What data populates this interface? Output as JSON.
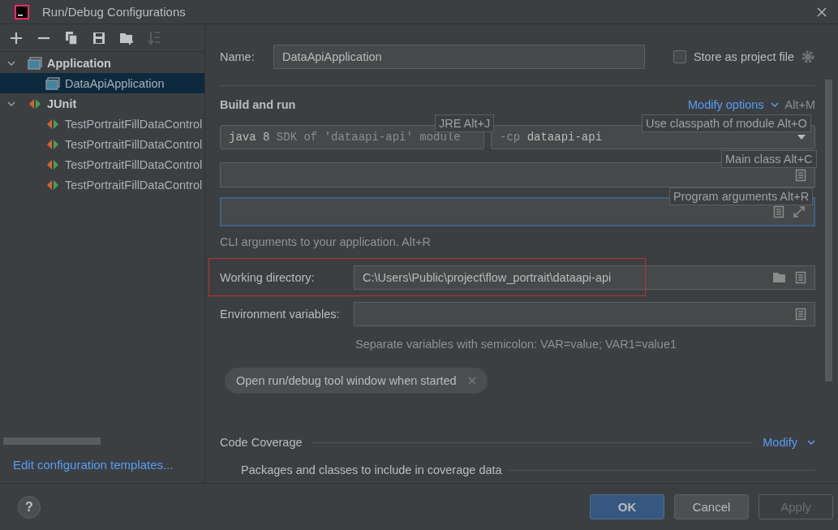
{
  "window": {
    "title": "Run/Debug Configurations"
  },
  "toolbar": [
    {
      "kind": "add",
      "disabled": false
    },
    {
      "kind": "remove",
      "disabled": false
    },
    {
      "kind": "copy",
      "disabled": false
    },
    {
      "kind": "save",
      "disabled": false
    },
    {
      "kind": "folder",
      "disabled": false
    },
    {
      "kind": "sort",
      "disabled": true
    }
  ],
  "tree": [
    {
      "label": "Application",
      "kind": "app",
      "expanded": true,
      "selected": false,
      "children": [
        {
          "label": "DataApiApplication",
          "kind": "app",
          "selected": true
        }
      ]
    },
    {
      "label": "JUnit",
      "kind": "junit",
      "expanded": true,
      "selected": false,
      "children": [
        {
          "label": "TestPortraitFillDataControl",
          "kind": "junit",
          "selected": false
        },
        {
          "label": "TestPortraitFillDataControl",
          "kind": "junit",
          "selected": false
        },
        {
          "label": "TestPortraitFillDataControl",
          "kind": "junit",
          "selected": false
        },
        {
          "label": "TestPortraitFillDataControl",
          "kind": "junit",
          "selected": false
        }
      ]
    }
  ],
  "templates_link": "Edit configuration templates...",
  "name": {
    "label": "Name:",
    "value": "DataApiApplication"
  },
  "store_as_project_file": {
    "label": "Store as project file",
    "checked": false
  },
  "build_and_run": {
    "title": "Build and run",
    "modify_options": "Modify options",
    "modify_shortcut": "Alt+M",
    "jre": {
      "value": "java 8",
      "detail": "SDK of 'dataapi-api' module"
    },
    "classpath": {
      "prefix": "-cp",
      "value": "dataapi-api"
    },
    "program_arguments": {
      "focused": true
    },
    "hint": "CLI arguments to your application. Alt+R"
  },
  "tooltips": [
    {
      "kind": "jre",
      "text": "JRE Alt+J"
    },
    {
      "kind": "classpath",
      "text": "Use classpath of module Alt+O"
    },
    {
      "kind": "main",
      "text": "Main class Alt+C"
    },
    {
      "kind": "args",
      "text": "Program arguments Alt+R"
    }
  ],
  "working_directory": {
    "label": "Working directory:",
    "value": "C:\\Users\\Public\\project\\flow_portrait\\dataapi-api",
    "highlighted": true
  },
  "environment_variables": {
    "label": "Environment variables:",
    "hint": "Separate variables with semicolon: VAR=value; VAR1=value1"
  },
  "option_chip": {
    "label": "Open run/debug tool window when started",
    "removable": true
  },
  "code_coverage": {
    "title": "Code Coverage",
    "modify": "Modify",
    "packages": "Packages and classes to include in coverage data"
  },
  "help": {
    "label": "?"
  },
  "buttons": [
    {
      "kind": "ok",
      "label": "OK",
      "disabled": false
    },
    {
      "kind": "cancel",
      "label": "Cancel",
      "disabled": false
    },
    {
      "kind": "apply",
      "label": "Apply",
      "disabled": true
    }
  ]
}
